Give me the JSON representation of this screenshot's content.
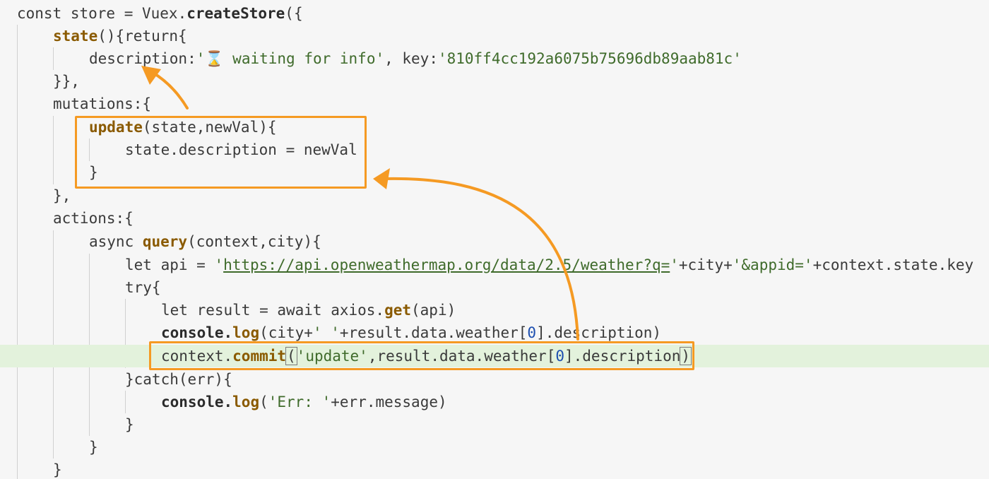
{
  "editor": {
    "lines": [
      {
        "id": "l1",
        "tokens": [
          {
            "t": "const store = Vuex.",
            "c": "tok-kw"
          },
          {
            "t": "createStore",
            "c": "tok-fn"
          },
          {
            "t": "({",
            "c": "tok-kw"
          }
        ]
      },
      {
        "id": "l2",
        "tokens": [
          {
            "t": "state",
            "c": "tok-mth"
          },
          {
            "t": "(){return{",
            "c": "tok-kw"
          }
        ]
      },
      {
        "id": "l3",
        "tokens": [
          {
            "t": "description:",
            "c": "tok-prop"
          },
          {
            "t": "'",
            "c": "tok-str"
          },
          {
            "t": "⌛",
            "c": "tok-icon"
          },
          {
            "t": " waiting for info'",
            "c": "tok-str"
          },
          {
            "t": ", key:",
            "c": "tok-kw"
          },
          {
            "t": "'810ff4cc192a6075b75696db89aab81c'",
            "c": "tok-str"
          }
        ]
      },
      {
        "id": "l4",
        "tokens": [
          {
            "t": "}},",
            "c": "tok-kw"
          }
        ]
      },
      {
        "id": "l5",
        "tokens": [
          {
            "t": "mutations:{",
            "c": "tok-kw"
          }
        ]
      },
      {
        "id": "l6",
        "tokens": [
          {
            "t": "update",
            "c": "tok-mth"
          },
          {
            "t": "(state,newVal){",
            "c": "tok-kw"
          }
        ]
      },
      {
        "id": "l7",
        "tokens": [
          {
            "t": "state.description = newVal",
            "c": "tok-kw"
          }
        ]
      },
      {
        "id": "l8",
        "tokens": [
          {
            "t": "}",
            "c": "tok-kw"
          }
        ]
      },
      {
        "id": "l9",
        "tokens": [
          {
            "t": "},",
            "c": "tok-kw"
          }
        ]
      },
      {
        "id": "l10",
        "tokens": [
          {
            "t": "actions:{",
            "c": "tok-kw"
          }
        ]
      },
      {
        "id": "l11",
        "tokens": [
          {
            "t": "async ",
            "c": "tok-kw"
          },
          {
            "t": "query",
            "c": "tok-mth"
          },
          {
            "t": "(context,city){",
            "c": "tok-kw"
          }
        ]
      },
      {
        "id": "l12",
        "tokens": [
          {
            "t": "let api = ",
            "c": "tok-kw"
          },
          {
            "t": "'",
            "c": "tok-str"
          },
          {
            "t": "https://api.openweathermap.org/data/2.5/weather?q=",
            "c": "tok-url"
          },
          {
            "t": "'",
            "c": "tok-str"
          },
          {
            "t": "+city+",
            "c": "tok-kw"
          },
          {
            "t": "'&appid='",
            "c": "tok-str"
          },
          {
            "t": "+context.state.key",
            "c": "tok-kw"
          }
        ]
      },
      {
        "id": "l13",
        "tokens": [
          {
            "t": "try{",
            "c": "tok-kw"
          }
        ]
      },
      {
        "id": "l14",
        "tokens": [
          {
            "t": "let result = await axios.",
            "c": "tok-kw"
          },
          {
            "t": "get",
            "c": "tok-mth"
          },
          {
            "t": "(api)",
            "c": "tok-kw"
          }
        ]
      },
      {
        "id": "l15",
        "tokens": [
          {
            "t": "console.",
            "c": "tok-fn"
          },
          {
            "t": "log",
            "c": "tok-mth"
          },
          {
            "t": "(city+",
            "c": "tok-kw"
          },
          {
            "t": "' '",
            "c": "tok-str"
          },
          {
            "t": "+result.data.weather[",
            "c": "tok-kw"
          },
          {
            "t": "0",
            "c": "tok-num"
          },
          {
            "t": "].description)",
            "c": "tok-kw"
          }
        ]
      },
      {
        "id": "l16",
        "tokens": [
          {
            "t": "context.",
            "c": "tok-kw"
          },
          {
            "t": "commit",
            "c": "tok-mth"
          },
          {
            "t": "(",
            "c": "brace-hl"
          },
          {
            "t": "'update'",
            "c": "tok-str"
          },
          {
            "t": ",result.data.weather[",
            "c": "tok-kw"
          },
          {
            "t": "0",
            "c": "tok-num"
          },
          {
            "t": "].description",
            "c": "tok-kw"
          },
          {
            "t": ")",
            "c": "brace-hl"
          }
        ]
      },
      {
        "id": "l17",
        "tokens": [
          {
            "t": "}catch(err){",
            "c": "tok-kw"
          }
        ]
      },
      {
        "id": "l18",
        "tokens": [
          {
            "t": "console.",
            "c": "tok-fn"
          },
          {
            "t": "log",
            "c": "tok-mth"
          },
          {
            "t": "(",
            "c": "tok-kw"
          },
          {
            "t": "'Err: '",
            "c": "tok-str"
          },
          {
            "t": "+err.message)",
            "c": "tok-kw"
          }
        ]
      },
      {
        "id": "l19",
        "tokens": [
          {
            "t": "}",
            "c": "tok-kw"
          }
        ]
      },
      {
        "id": "l20",
        "tokens": [
          {
            "t": "}",
            "c": "tok-kw"
          }
        ]
      },
      {
        "id": "l21",
        "tokens": [
          {
            "t": "}",
            "c": "tok-kw"
          }
        ]
      }
    ],
    "active_line": "l16"
  },
  "colors": {
    "accent": "#f59a23",
    "active_line_bg": "#e3f2dc",
    "background": "#f6f6f6"
  }
}
